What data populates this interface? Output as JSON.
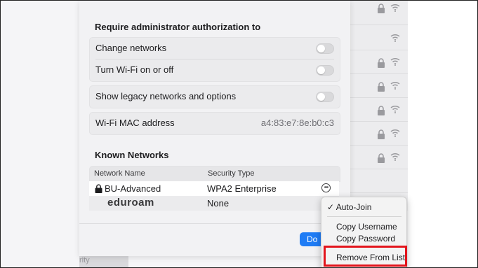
{
  "security_section": {
    "title": "Require administrator authorization to",
    "rows": [
      {
        "label": "Change networks",
        "toggle": "off"
      },
      {
        "label": "Turn Wi-Fi on or off",
        "toggle": "off"
      }
    ]
  },
  "legacy": {
    "label": "Show legacy networks and options",
    "toggle": "off"
  },
  "mac": {
    "label": "Wi-Fi MAC address",
    "value": "a4:83:e7:8e:b0:c3"
  },
  "known_networks": {
    "title": "Known Networks",
    "col_name": "Network Name",
    "col_security": "Security Type",
    "networks": [
      {
        "name": "BU-Advanced",
        "security": "WPA2 Enterprise",
        "locked": true
      },
      {
        "name": "eduroam",
        "security": "None",
        "locked": false
      }
    ]
  },
  "done_button": {
    "label": "Do"
  },
  "sidebar_fragment": {
    "text": "rity"
  },
  "context_menu": {
    "items": [
      {
        "label": "✓ Auto-Join"
      },
      {
        "label": "Copy Username"
      },
      {
        "label": "Copy Password"
      },
      {
        "label": "Remove From List"
      }
    ]
  },
  "colors": {
    "accent": "#1f7cf5",
    "highlight": "#e3141c"
  }
}
